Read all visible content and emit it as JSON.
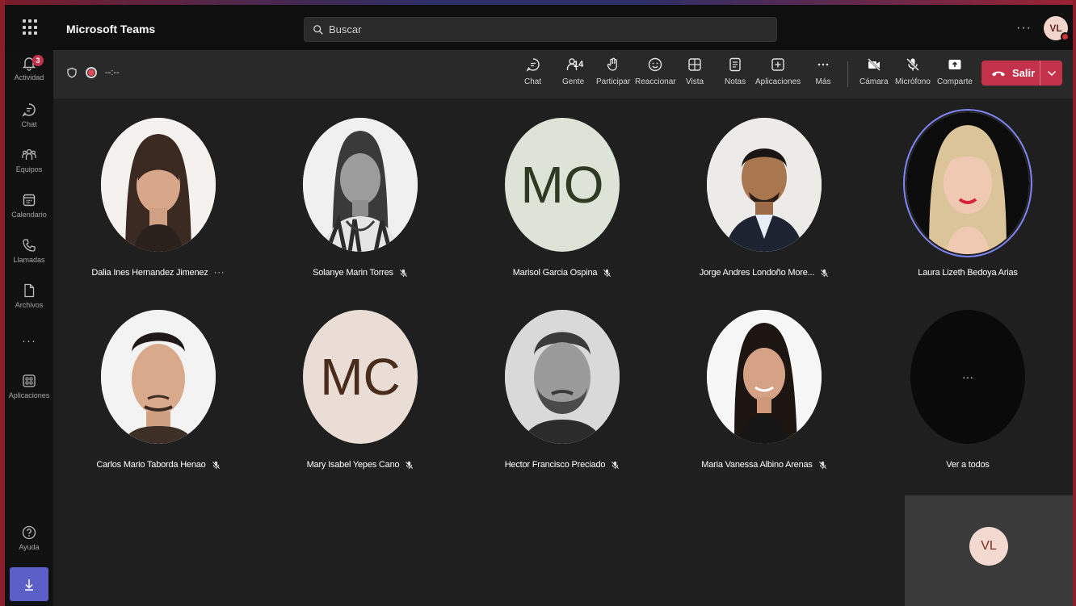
{
  "app": {
    "title": "Microsoft Teams"
  },
  "search": {
    "placeholder": "Buscar"
  },
  "user": {
    "initials": "VL"
  },
  "rail": {
    "items": [
      {
        "label": "Actividad",
        "badge": "3"
      },
      {
        "label": "Chat"
      },
      {
        "label": "Equipos"
      },
      {
        "label": "Calendario"
      },
      {
        "label": "Llamadas"
      },
      {
        "label": "Archivos"
      },
      {
        "label": "Aplicaciones"
      },
      {
        "label": "Ayuda"
      }
    ],
    "more": "···"
  },
  "meeting": {
    "timer": "--:--",
    "toolbar": {
      "chat": "Chat",
      "people": "Gente",
      "people_count": "14",
      "raise": "Participar",
      "react": "Reaccionar",
      "view": "Vista",
      "notes": "Notas",
      "apps": "Aplicaciones",
      "more": "Más",
      "camera": "Cámara",
      "mic": "Micrófono",
      "share": "Comparte",
      "leave": "Salir"
    }
  },
  "participants": [
    {
      "name": "Dalia Ines Hernandez Jimenez",
      "kind": "photo"
    },
    {
      "name": "Solanye Marin Torres",
      "kind": "photo"
    },
    {
      "name": "Marisol Garcia Ospina",
      "kind": "initials",
      "initials": "MO",
      "bg": "#dde3d6",
      "fg": "#2f3a22"
    },
    {
      "name": "Jorge Andres Londoño More...",
      "kind": "photo"
    },
    {
      "name": "Laura Lizeth Bedoya Arias",
      "kind": "photo"
    },
    {
      "name": "Carlos Mario Taborda Henao",
      "kind": "photo"
    },
    {
      "name": "Mary Isabel Yepes Cano",
      "kind": "initials",
      "initials": "MC",
      "bg": "#e9ddd6",
      "fg": "#4a2c1c"
    },
    {
      "name": "Hector Francisco Preciado",
      "kind": "photo"
    },
    {
      "name": "Maria Vanessa Albino Arenas",
      "kind": "photo"
    }
  ],
  "overflow": {
    "label": "Ver a todos",
    "dots": "···"
  },
  "self_view": {
    "initials": "VL"
  },
  "colors": {
    "accent": "#5b5fc7",
    "leave": "#c4314b",
    "speaking": "#7f85f5"
  }
}
